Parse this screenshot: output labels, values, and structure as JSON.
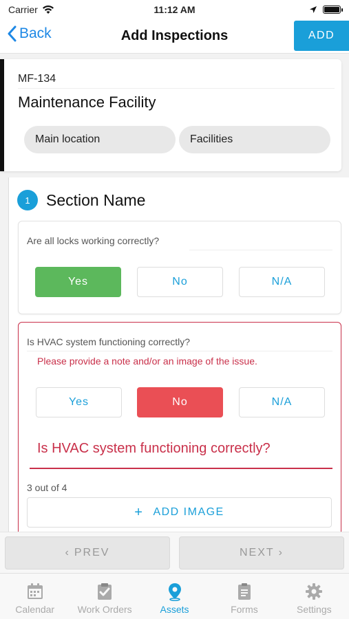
{
  "status_bar": {
    "carrier": "Carrier",
    "time": "11:12 AM",
    "battery_level": 1.0
  },
  "nav": {
    "back_label": "Back",
    "title": "Add Inspections",
    "add_label": "ADD"
  },
  "asset": {
    "code": "MF-134",
    "name": "Maintenance Facility",
    "chips": [
      "Main location",
      "Facilities"
    ]
  },
  "section": {
    "number": "1",
    "title": "Section Name",
    "questions": [
      {
        "text": "Are all locks working correctly?",
        "answers": [
          "Yes",
          "No",
          "N/A"
        ],
        "selected": "Yes"
      },
      {
        "text": "Is HVAC system functioning correctly?",
        "error": "Please provide a note and/or an image of the issue.",
        "answers": [
          "Yes",
          "No",
          "N/A"
        ],
        "selected": "No",
        "note_value": "Is HVAC system functioning correctly?",
        "counter": "3 out of 4",
        "add_image_label": "ADD IMAGE"
      }
    ]
  },
  "pager": {
    "prev_label": "PREV",
    "next_label": "NEXT"
  },
  "tabs": [
    {
      "label": "Calendar",
      "icon": "calendar-icon",
      "active": false
    },
    {
      "label": "Work Orders",
      "icon": "clipboard-check-icon",
      "active": false
    },
    {
      "label": "Assets",
      "icon": "location-pin-icon",
      "active": true
    },
    {
      "label": "Forms",
      "icon": "forms-icon",
      "active": false
    },
    {
      "label": "Settings",
      "icon": "gear-icon",
      "active": false
    }
  ],
  "colors": {
    "accent": "#1a9fd9",
    "yes_selected": "#5cb85c",
    "no_selected": "#ea4f55",
    "error": "#c9304a"
  }
}
